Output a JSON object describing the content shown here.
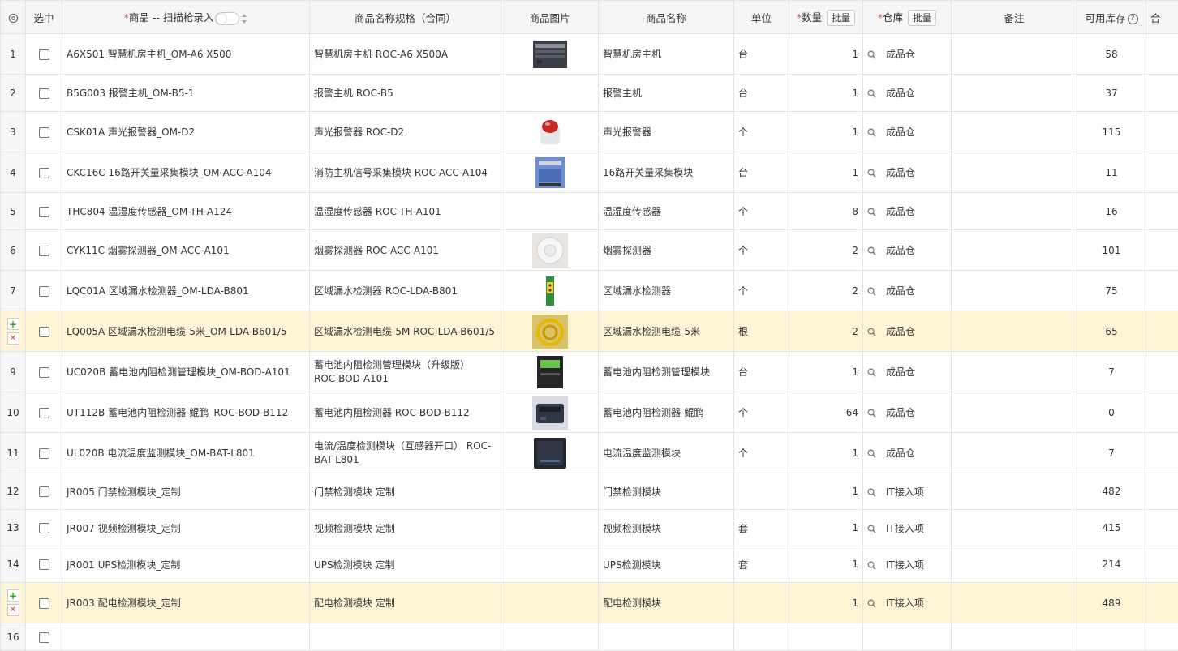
{
  "header": {
    "select": "选中",
    "product_label": "商品 -- 扫描枪录入",
    "spec": "商品名称规格（合同）",
    "image": "商品图片",
    "name": "商品名称",
    "unit": "单位",
    "qty": "数量",
    "qty_batch": "批量",
    "warehouse": "仓库",
    "warehouse_batch": "批量",
    "remark": "备注",
    "stock": "可用库存",
    "cut_col": "合"
  },
  "colors": {
    "highlight_row": "#fdf5d5",
    "required_mark": "#e84b4b",
    "add_icon": "#2aa52a",
    "delete_icon": "#e23a3a"
  },
  "rows": [
    {
      "idx": "1",
      "product": "A6X501 智慧机房主机_OM-A6 X500",
      "spec": "智慧机房主机 ROC-A6 X500A",
      "image": "host-device-photo",
      "name": "智慧机房主机",
      "unit": "台",
      "qty": "1",
      "warehouse": "成品仓",
      "remark": "",
      "stock": "58"
    },
    {
      "idx": "2",
      "product": "B5G003 报警主机_OM-B5-1",
      "spec": "报警主机 ROC-B5",
      "image": "",
      "name": "报警主机",
      "unit": "台",
      "qty": "1",
      "warehouse": "成品仓",
      "remark": "",
      "stock": "37"
    },
    {
      "idx": "3",
      "product": "CSK01A 声光报警器_OM-D2",
      "spec": "声光报警器 ROC-D2",
      "image": "alarm-siren-photo",
      "name": "声光报警器",
      "unit": "个",
      "qty": "1",
      "warehouse": "成品仓",
      "remark": "",
      "stock": "115"
    },
    {
      "idx": "4",
      "product": "CKC16C 16路开关量采集模块_OM-ACC-A104",
      "spec": "消防主机信号采集模块 ROC-ACC-A104",
      "image": "module-photo",
      "name": "16路开关量采集模块",
      "unit": "台",
      "qty": "1",
      "warehouse": "成品仓",
      "remark": "",
      "stock": "11"
    },
    {
      "idx": "5",
      "product": "THC804 温湿度传感器_OM-TH-A124",
      "spec": "温湿度传感器 ROC-TH-A101",
      "image": "",
      "name": "温湿度传感器",
      "unit": "个",
      "qty": "8",
      "warehouse": "成品仓",
      "remark": "",
      "stock": "16"
    },
    {
      "idx": "6",
      "product": "CYK11C 烟雾探测器_OM-ACC-A101",
      "spec": "烟雾探测器 ROC-ACC-A101",
      "image": "smoke-detector-photo",
      "name": "烟雾探测器",
      "unit": "个",
      "qty": "2",
      "warehouse": "成品仓",
      "remark": "",
      "stock": "101"
    },
    {
      "idx": "7",
      "product": "LQC01A 区域漏水检测器_OM-LDA-B801",
      "spec": "区域漏水检测器 ROC-LDA-B801",
      "image": "leak-detector-photo",
      "name": "区域漏水检测器",
      "unit": "个",
      "qty": "2",
      "warehouse": "成品仓",
      "remark": "",
      "stock": "75"
    },
    {
      "idx": "",
      "product": "LQ005A 区域漏水检测电缆-5米_OM-LDA-B601/5",
      "spec": "区域漏水检测电缆-5M ROC-LDA-B601/5",
      "image": "cable-coil-photo",
      "name": "区域漏水检测电缆-5米",
      "unit": "根",
      "qty": "2",
      "warehouse": "成品仓",
      "remark": "",
      "stock": "65",
      "highlight": true
    },
    {
      "idx": "9",
      "product": "UC020B 蓄电池内阻检测管理模块_OM-BOD-A101",
      "spec": "蓄电池内阻检测管理模块（升级版） ROC-BOD-A101",
      "image": "battery-module-photo",
      "name": "蓄电池内阻检测管理模块",
      "unit": "台",
      "qty": "1",
      "warehouse": "成品仓",
      "remark": "",
      "stock": "7",
      "wrap": true
    },
    {
      "idx": "10",
      "product": "UT112B 蓄电池内阻检测器-鲲鹏_ROC-BOD-B112",
      "spec": "蓄电池内阻检测器 ROC-BOD-B112",
      "image": "battery-tester-photo",
      "name": "蓄电池内阻检测器-鲲鹏",
      "unit": "个",
      "qty": "64",
      "warehouse": "成品仓",
      "remark": "",
      "stock": "0"
    },
    {
      "idx": "11",
      "product": "UL020B 电流温度监测模块_OM-BAT-L801",
      "spec": "电流/温度检测模块（互感器开口） ROC-BAT-L801",
      "image": "current-module-photo",
      "name": "电流温度监测模块",
      "unit": "个",
      "qty": "1",
      "warehouse": "成品仓",
      "remark": "",
      "stock": "7",
      "wrap": true
    },
    {
      "idx": "12",
      "product": "JR005 门禁检测模块_定制",
      "spec": "门禁检测模块 定制",
      "image": "",
      "name": "门禁检测模块",
      "unit": "",
      "qty": "1",
      "warehouse": "IT接入项",
      "remark": "",
      "stock": "482"
    },
    {
      "idx": "13",
      "product": "JR007 视频检测模块_定制",
      "spec": "视频检测模块 定制",
      "image": "",
      "name": "视频检测模块",
      "unit": "套",
      "qty": "1",
      "warehouse": "IT接入项",
      "remark": "",
      "stock": "415"
    },
    {
      "idx": "14",
      "product": "JR001 UPS检测模块_定制",
      "spec": "UPS检测模块 定制",
      "image": "",
      "name": "UPS检测模块",
      "unit": "套",
      "qty": "1",
      "warehouse": "IT接入项",
      "remark": "",
      "stock": "214"
    },
    {
      "idx": "",
      "product": "JR003 配电检测模块_定制",
      "spec": "配电检测模块 定制",
      "image": "",
      "name": "配电检测模块",
      "unit": "",
      "qty": "1",
      "warehouse": "IT接入项",
      "remark": "",
      "stock": "489",
      "highlight": true
    },
    {
      "idx": "16",
      "product": "",
      "spec": "",
      "image": "",
      "name": "",
      "unit": "",
      "qty": "",
      "warehouse": "",
      "remark": "",
      "stock": "",
      "empty": true
    }
  ]
}
